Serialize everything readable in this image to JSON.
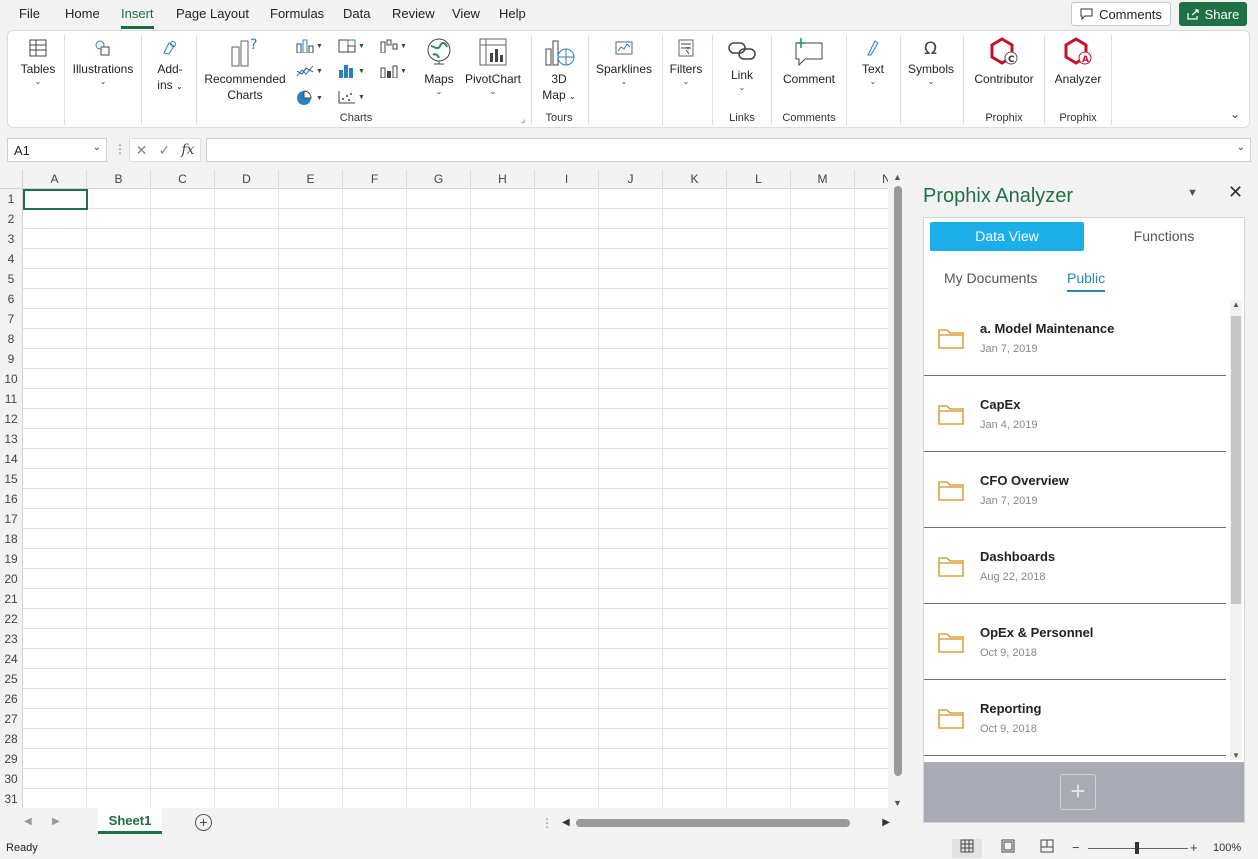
{
  "menu": {
    "tabs": [
      {
        "label": "File"
      },
      {
        "label": "Home"
      },
      {
        "label": "Insert"
      },
      {
        "label": "Page Layout"
      },
      {
        "label": "Formulas"
      },
      {
        "label": "Data"
      },
      {
        "label": "Review"
      },
      {
        "label": "View"
      },
      {
        "label": "Help"
      }
    ],
    "active_tab": "Insert",
    "comments_label": "Comments",
    "share_label": "Share"
  },
  "ribbon": {
    "tables": {
      "label": "Tables"
    },
    "illustrations": {
      "label": "Illustrations"
    },
    "addins": {
      "line1": "Add-",
      "line2": "ins"
    },
    "recommended_charts": {
      "line1": "Recommended",
      "line2": "Charts"
    },
    "maps": {
      "label": "Maps"
    },
    "pivotchart": {
      "label": "PivotChart"
    },
    "map3d": {
      "line1": "3D",
      "line2": "Map"
    },
    "sparklines": {
      "label": "Sparklines"
    },
    "filters": {
      "label": "Filters"
    },
    "link": {
      "label": "Link"
    },
    "comment": {
      "label": "Comment"
    },
    "text": {
      "label": "Text"
    },
    "symbols": {
      "label": "Symbols"
    },
    "contributor": {
      "label": "Contributor"
    },
    "analyzer": {
      "label": "Analyzer"
    },
    "groups": {
      "charts": "Charts",
      "tours": "Tours",
      "links": "Links",
      "comments": "Comments",
      "prophix1": "Prophix",
      "prophix2": "Prophix"
    }
  },
  "formula_bar": {
    "name_box": "A1",
    "value": ""
  },
  "grid": {
    "columns": [
      "A",
      "B",
      "C",
      "D",
      "E",
      "F",
      "G",
      "H",
      "I",
      "J",
      "K",
      "L",
      "M",
      "N"
    ],
    "rows": [
      "1",
      "2",
      "3",
      "4",
      "5",
      "6",
      "7",
      "8",
      "9",
      "10",
      "11",
      "12",
      "13",
      "14",
      "15",
      "16",
      "17",
      "18",
      "19",
      "20",
      "21",
      "22",
      "23",
      "24",
      "25",
      "26",
      "27",
      "28",
      "29",
      "30",
      "31"
    ],
    "selected_cell": "A1"
  },
  "sheets": {
    "tabs": [
      "Sheet1"
    ],
    "active": "Sheet1"
  },
  "status": {
    "text": "Ready",
    "zoom": "100%"
  },
  "pane": {
    "title": "Prophix Analyzer",
    "tabs": {
      "data_view": "Data View",
      "functions": "Functions"
    },
    "subtabs": {
      "my_documents": "My Documents",
      "public": "Public"
    },
    "items": [
      {
        "name": "a. Model Maintenance",
        "date": "Jan 7, 2019"
      },
      {
        "name": "CapEx",
        "date": "Jan 4, 2019"
      },
      {
        "name": "CFO Overview",
        "date": "Jan 7, 2019"
      },
      {
        "name": "Dashboards",
        "date": "Aug 22, 2018"
      },
      {
        "name": "OpEx & Personnel",
        "date": "Oct 9, 2018"
      },
      {
        "name": "Reporting",
        "date": "Oct 9, 2018"
      }
    ],
    "add_label": "+"
  },
  "colors": {
    "excel_green": "#1e7145",
    "data_view_blue": "#1baee8",
    "folder": "#d9a441",
    "public_blue": "#2a86b6"
  }
}
